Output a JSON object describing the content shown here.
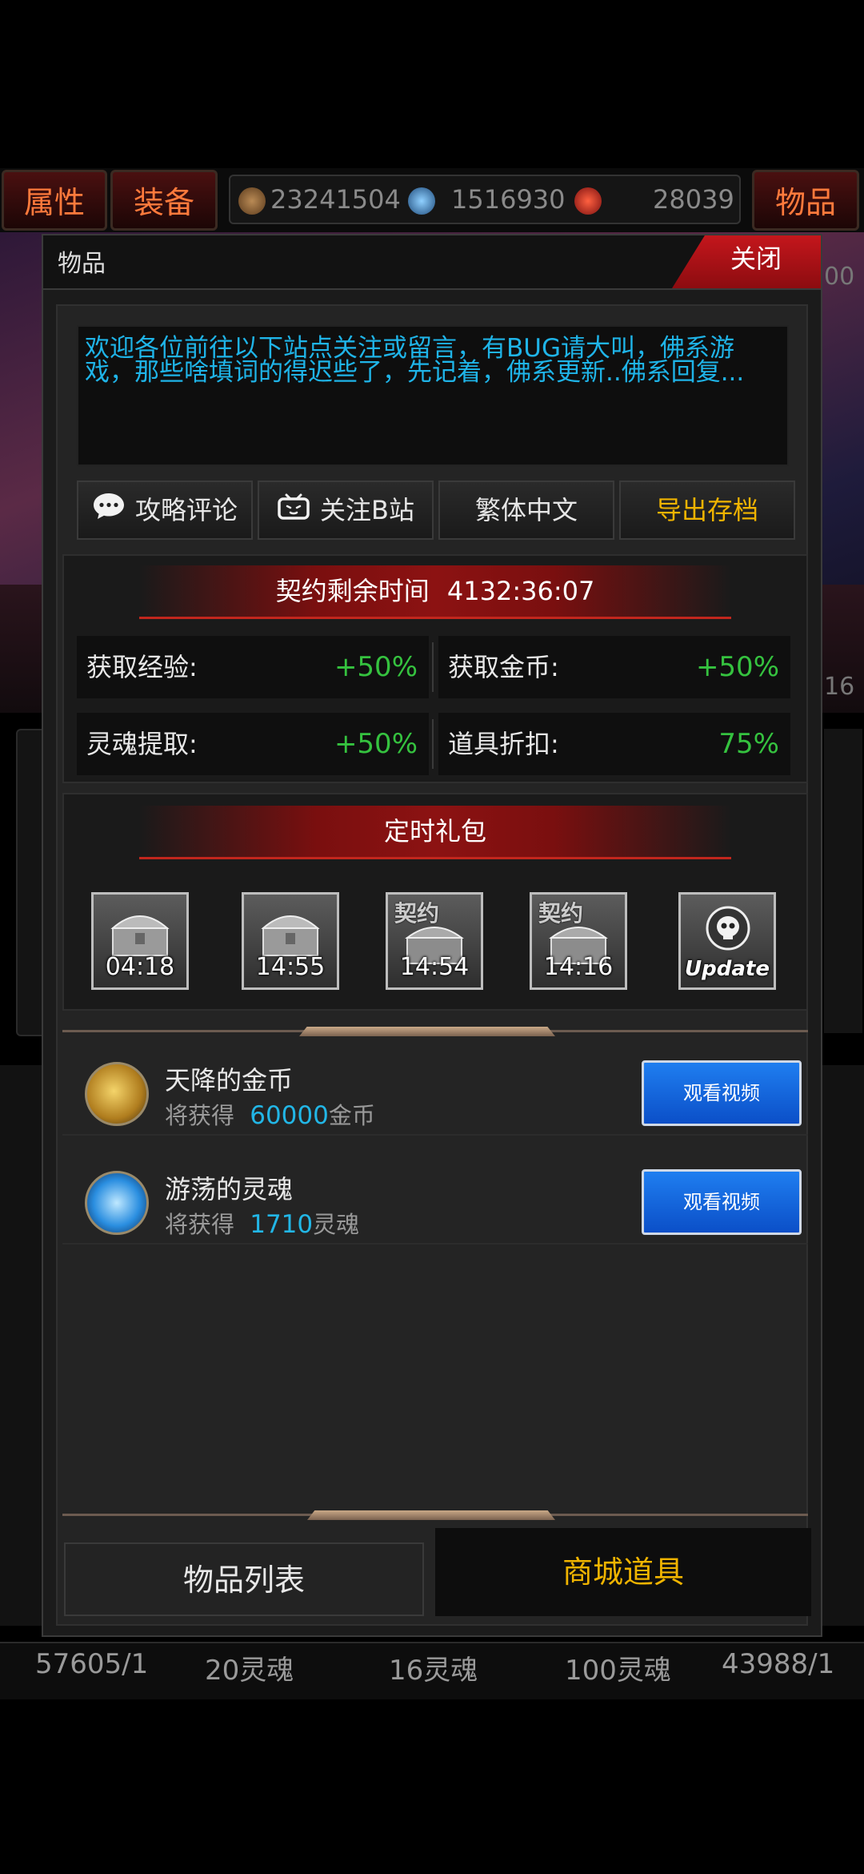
{
  "top_tabs": {
    "attributes": "属性",
    "equipment": "装备",
    "items": "物品"
  },
  "resources": [
    {
      "icon": "bronze-coin-icon",
      "value": "23241504"
    },
    {
      "icon": "blue-soul-icon",
      "value": "1516930"
    },
    {
      "icon": "red-gem-icon",
      "value": "28039"
    }
  ],
  "modal": {
    "title": "物品",
    "close_label": "关闭",
    "notice": "欢迎各位前往以下站点关注或留言，有BUG请大叫，佛系游戏，那些啥填词的得迟些了，先记着，佛系更新..佛系回复...",
    "buttons": [
      {
        "label": "攻略评论",
        "icon": "comment-icon"
      },
      {
        "label": "关注B站",
        "icon": "bilibili-tv-icon"
      },
      {
        "label": "繁体中文",
        "icon": ""
      },
      {
        "label": "导出存档",
        "icon": ""
      }
    ],
    "contract": {
      "title": "契约剩余时间",
      "time": "4132:36:07",
      "stats": [
        {
          "label": "获取经验:",
          "value": "+50%"
        },
        {
          "label": "获取金币:",
          "value": "+50%"
        },
        {
          "label": "灵魂提取:",
          "value": "+50%"
        },
        {
          "label": "道具折扣:",
          "value": "75%"
        }
      ]
    },
    "gift": {
      "title": "定时礼包",
      "items": [
        {
          "icon": "treasure-chest-icon",
          "tag": "",
          "timer": "04:18"
        },
        {
          "icon": "treasure-chest-icon",
          "tag": "",
          "timer": "14:55"
        },
        {
          "icon": "contract-chest-icon",
          "tag": "契约",
          "timer": "14:54"
        },
        {
          "icon": "contract-chest-icon",
          "tag": "契约",
          "timer": "14:16"
        },
        {
          "icon": "skull-update-icon",
          "tag": "",
          "timer": "Update"
        }
      ]
    },
    "rewards": [
      {
        "title": "天降的金币",
        "prefix": "将获得",
        "amount": "60000",
        "unit": "金币",
        "button": "观看视频",
        "icon": "gold-coins-icon"
      },
      {
        "title": "游荡的灵魂",
        "prefix": "将获得",
        "amount": "1710",
        "unit": "灵魂",
        "button": "观看视频",
        "icon": "blue-soul-icon"
      }
    ],
    "tabs": {
      "item_list": "物品列表",
      "shop_items": "商城道具"
    }
  },
  "background": {
    "right_edge_value": "00",
    "right_edge_num2": "16",
    "bottom_values": [
      "57605/1",
      "20灵魂",
      "16灵魂",
      "100灵魂",
      "43988/1"
    ]
  },
  "colors": {
    "accent_red": "#c4161c",
    "stat_green": "#35c23f",
    "link_blue": "#1fb4e8",
    "gold_tab": "#f0b400"
  }
}
